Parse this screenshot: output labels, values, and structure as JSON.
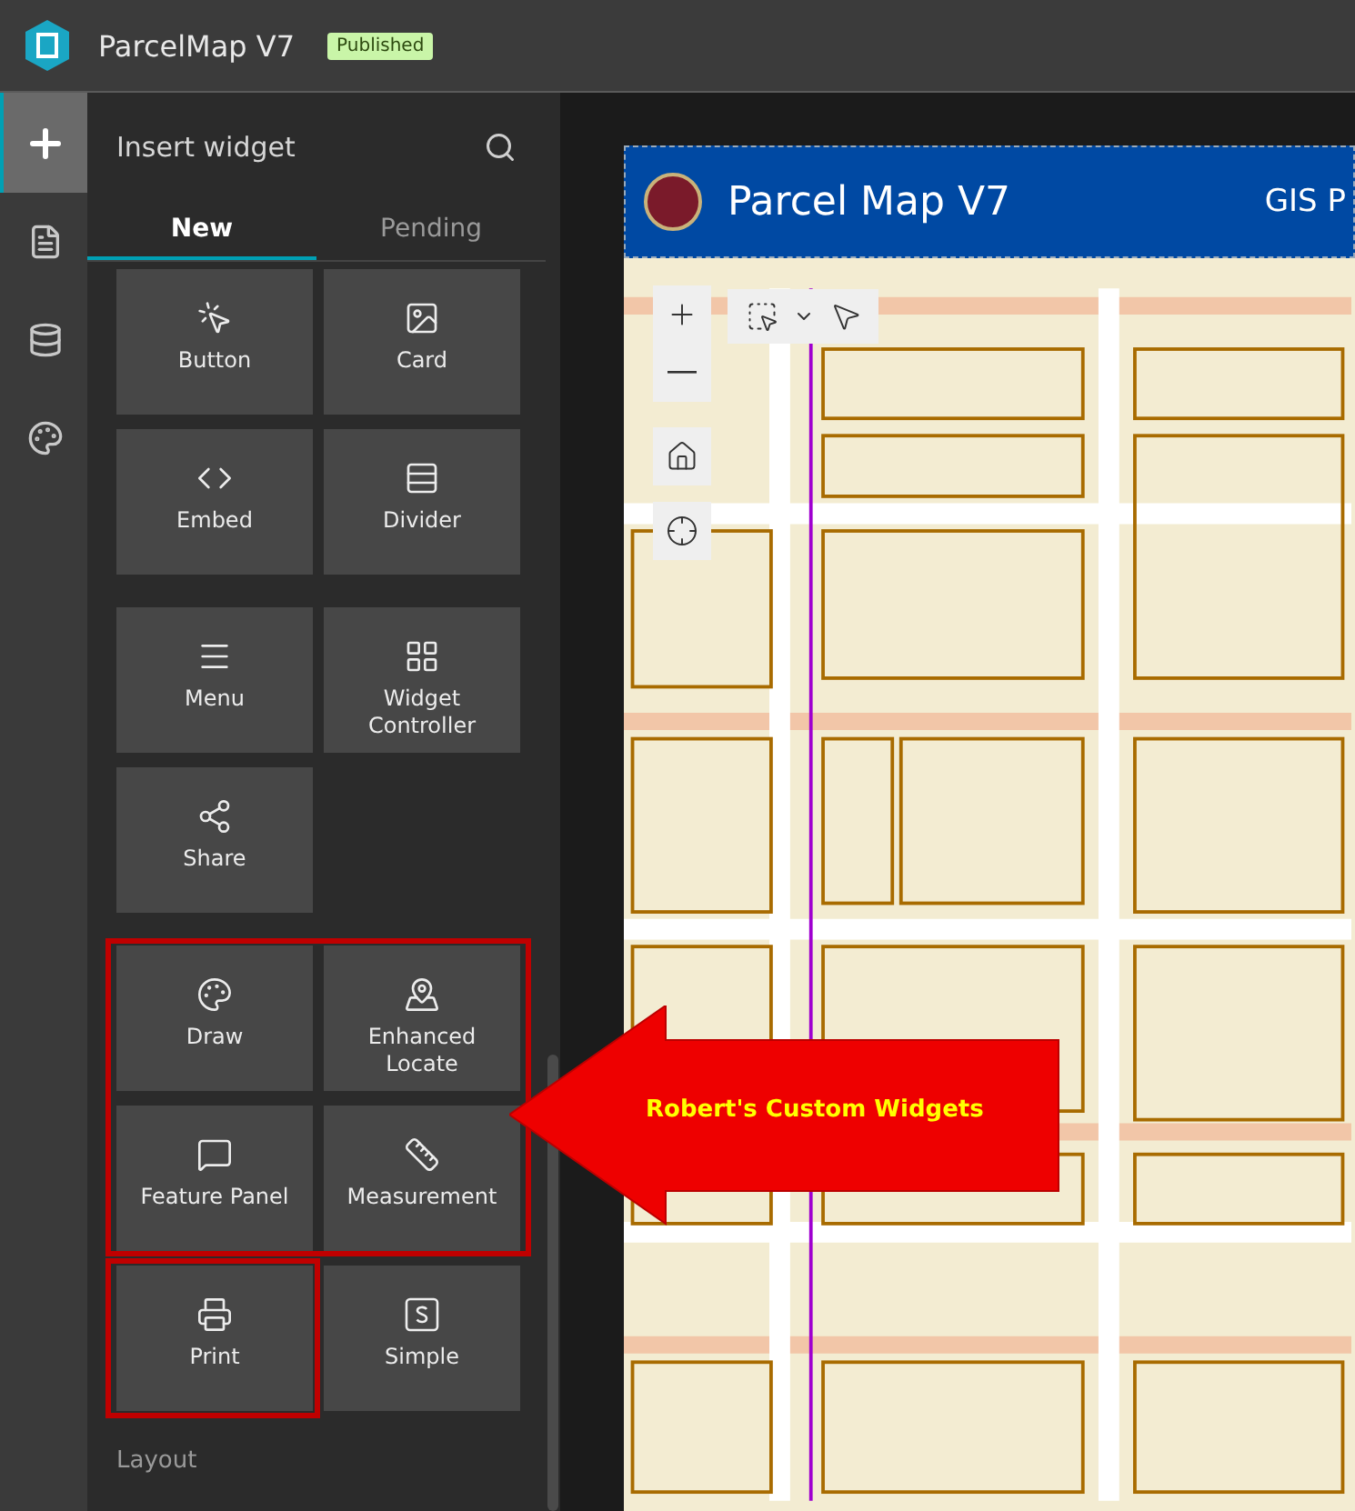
{
  "app": {
    "title": "ParcelMap V7",
    "status": "Published"
  },
  "rail": [
    {
      "kind": "add",
      "selected": true
    },
    {
      "kind": "page",
      "selected": false
    },
    {
      "kind": "data",
      "selected": false
    },
    {
      "kind": "theme",
      "selected": false
    }
  ],
  "panel": {
    "title": "Insert widget",
    "tabs": [
      {
        "label": "New",
        "selected": true
      },
      {
        "label": "Pending",
        "selected": false
      }
    ],
    "groups": [
      {
        "widgets": [
          {
            "label": "Button",
            "kind": "button"
          },
          {
            "label": "Card",
            "kind": "card"
          },
          {
            "label": "Embed",
            "kind": "embed"
          },
          {
            "label": "Divider",
            "kind": "divider"
          }
        ]
      },
      {
        "widgets": [
          {
            "label": "Menu",
            "kind": "menu"
          },
          {
            "label": "Widget Controller",
            "kind": "controller"
          },
          {
            "label": "Share",
            "kind": "share"
          }
        ]
      },
      {
        "widgets": [
          {
            "label": "Draw",
            "kind": "draw"
          },
          {
            "label": "Enhanced Locate",
            "kind": "locate"
          },
          {
            "label": "Feature Panel",
            "kind": "feature"
          },
          {
            "label": "Measurement",
            "kind": "measure"
          },
          {
            "label": "Print",
            "kind": "print"
          },
          {
            "label": "Simple",
            "kind": "simple"
          }
        ]
      }
    ],
    "next_section": "Layout"
  },
  "annotation": {
    "label": "Robert's Custom Widgets"
  },
  "preview": {
    "title": "Parcel Map V7",
    "subtitle": "GIS P"
  }
}
